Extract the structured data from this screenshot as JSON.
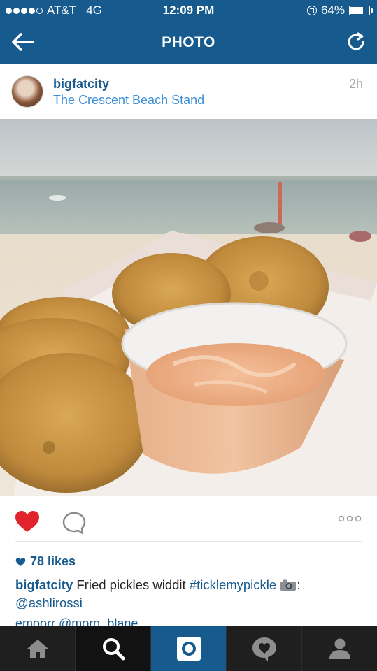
{
  "status_bar": {
    "carrier": "AT&T",
    "network": "4G",
    "time": "12:09 PM",
    "battery_text": "64%",
    "battery_level": 0.64
  },
  "nav": {
    "title": "PHOTO",
    "back_icon": "arrow-left-icon",
    "refresh_icon": "refresh-icon"
  },
  "post": {
    "username": "bigfatcity",
    "location": "The Crescent Beach Stand",
    "time_ago": "2h"
  },
  "actions": {
    "like_icon": "heart-icon",
    "comment_icon": "comment-bubble-icon",
    "more_icon": "ellipsis-icon",
    "like_color": "#e0232d"
  },
  "likes": {
    "text": "78 likes"
  },
  "caption": {
    "user": "bigfatcity",
    "text_before": " Fried pickles widdit ",
    "hashtag": "#ticklemypickle",
    "text_after": ":",
    "mention": "@ashlirossi"
  },
  "comment_peek": {
    "text": "emoorr @morg_blane"
  },
  "tabs": [
    {
      "name": "home-icon",
      "active": false
    },
    {
      "name": "search-icon",
      "active": true
    },
    {
      "name": "camera-icon",
      "active": false
    },
    {
      "name": "activity-icon",
      "active": false
    },
    {
      "name": "profile-icon",
      "active": false
    }
  ],
  "colors": {
    "brand_blue": "#175a8e",
    "link_blue": "#3d8fd6",
    "tabbar_dark": "#1f1f1f"
  }
}
